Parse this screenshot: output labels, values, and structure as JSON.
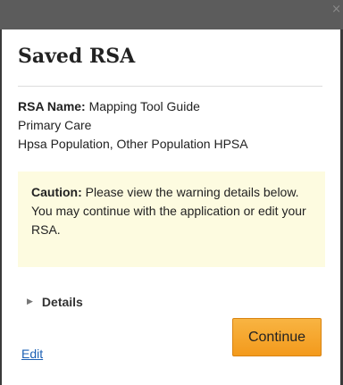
{
  "dialog": {
    "title": "Saved RSA",
    "close_glyph": "×"
  },
  "rsa": {
    "name_label": "RSA Name:",
    "name_value": "Mapping Tool Guide",
    "line2": "Primary Care",
    "line3": "Hpsa Population, Other Population HPSA"
  },
  "caution": {
    "label": "Caution:",
    "message": "Please view the warning details below. You may continue with the application or edit your RSA."
  },
  "details": {
    "arrow_glyph": "▶",
    "label": "Details",
    "icon": "triangle-right-icon"
  },
  "actions": {
    "edit_label": "Edit",
    "continue_label": "Continue"
  },
  "colors": {
    "titlebar": "#5c5c5c",
    "caution_bg": "#fdfbe0",
    "continue_btn": "#f5a52a",
    "link": "#1a5fb4"
  }
}
